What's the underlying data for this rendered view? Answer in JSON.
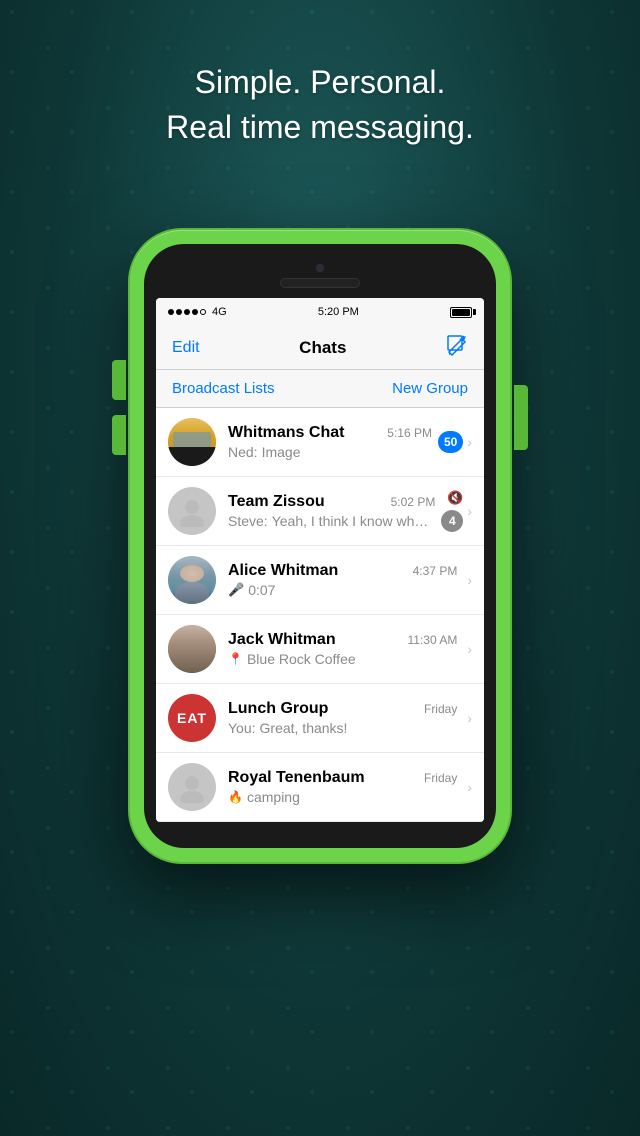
{
  "background": {
    "tagline_line1": "Simple. Personal.",
    "tagline_line2": "Real time messaging."
  },
  "status_bar": {
    "signal": "●●●●○ 4G",
    "time": "5:20 PM",
    "battery": "full"
  },
  "nav": {
    "edit_label": "Edit",
    "title": "Chats",
    "compose_icon": "✏"
  },
  "action_bar": {
    "broadcast_label": "Broadcast Lists",
    "new_group_label": "New Group"
  },
  "chats": [
    {
      "id": "whitmans",
      "name": "Whitmans Chat",
      "time": "5:16 PM",
      "sender": "Ned:",
      "preview": "Image",
      "badge": "50",
      "muted": false
    },
    {
      "id": "team_zissou",
      "name": "Team Zissou",
      "time": "5:02 PM",
      "sender": "Steve:",
      "preview": "Yeah, I think I know wha...",
      "badge": "4",
      "muted": true
    },
    {
      "id": "alice",
      "name": "Alice Whitman",
      "time": "4:37 PM",
      "sender": "",
      "preview": "0:07",
      "badge": "",
      "muted": false,
      "has_mic": true
    },
    {
      "id": "jack",
      "name": "Jack Whitman",
      "time": "11:30 AM",
      "sender": "",
      "preview": "Blue Rock Coffee",
      "badge": "",
      "muted": false,
      "has_location": true
    },
    {
      "id": "lunch",
      "name": "Lunch Group",
      "time": "Friday",
      "sender": "You:",
      "preview": "Great, thanks!",
      "badge": "",
      "muted": false
    },
    {
      "id": "royal",
      "name": "Royal Tenenbaum",
      "time": "Friday",
      "sender": "",
      "preview": "camping",
      "badge": "",
      "muted": false,
      "has_fire": true
    }
  ]
}
